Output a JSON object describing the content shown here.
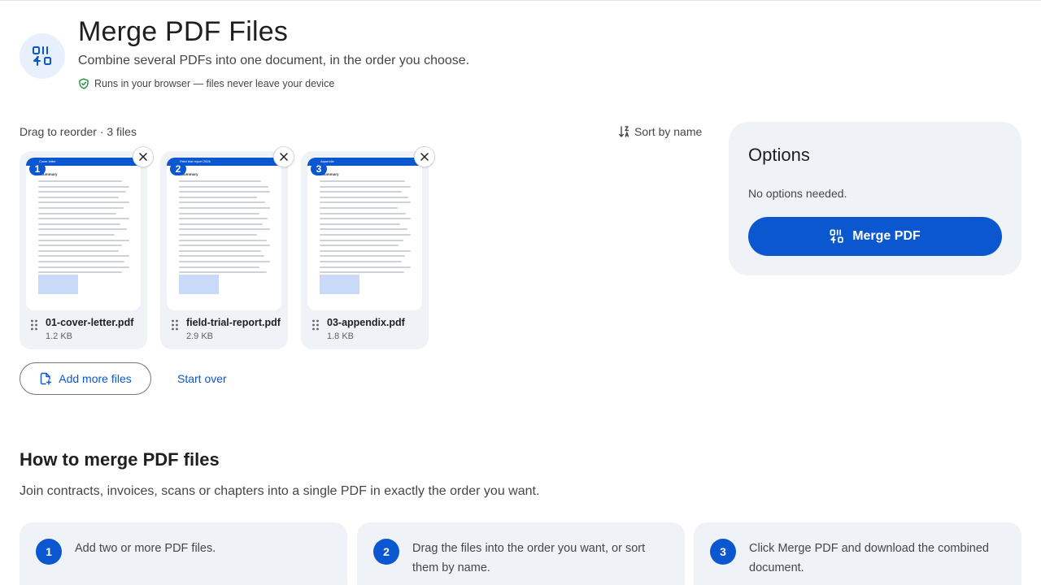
{
  "header": {
    "title": "Merge PDF Files",
    "subtitle": "Combine several PDFs into one document, in the order you choose.",
    "privacy_note": "Runs in your browser — files never leave your device"
  },
  "files_area": {
    "meta": "Drag to reorder · 3 files",
    "sort_label": "Sort by name"
  },
  "files": [
    {
      "index": "1",
      "name": "01-cover-letter.pdf",
      "size": "1.2 KB",
      "thumb_bar_text": "Cover letter",
      "thumb_heading": "Summary"
    },
    {
      "index": "2",
      "name": "field-trial-report.pdf",
      "size": "2.9 KB",
      "thumb_bar_text": "Field trial report 2026",
      "thumb_heading": "Summary"
    },
    {
      "index": "3",
      "name": "03-appendix.pdf",
      "size": "1.8 KB",
      "thumb_bar_text": "Appendix",
      "thumb_heading": "Summary"
    }
  ],
  "actions": {
    "add_more": "Add more files",
    "start_over": "Start over"
  },
  "options": {
    "title": "Options",
    "note": "No options needed.",
    "merge_label": "Merge PDF"
  },
  "howto": {
    "title": "How to merge PDF files",
    "description": "Join contracts, invoices, scans or chapters into a single PDF in exactly the order you want.",
    "steps": [
      {
        "num": "1",
        "text": "Add two or more PDF files."
      },
      {
        "num": "2",
        "text": "Drag the files into the order you want, or sort them by name."
      },
      {
        "num": "3",
        "text": "Click Merge PDF and download the combined document."
      }
    ]
  },
  "colors": {
    "accent": "#0b57d0",
    "card_bg": "#eff2f7",
    "icon_bg": "#e8f0fe"
  },
  "icons": {
    "app": "merge-icon",
    "privacy": "shield-check-icon",
    "sort": "sort-icon",
    "remove": "close-icon",
    "drag": "drag-handle-icon",
    "add": "add-file-icon"
  }
}
